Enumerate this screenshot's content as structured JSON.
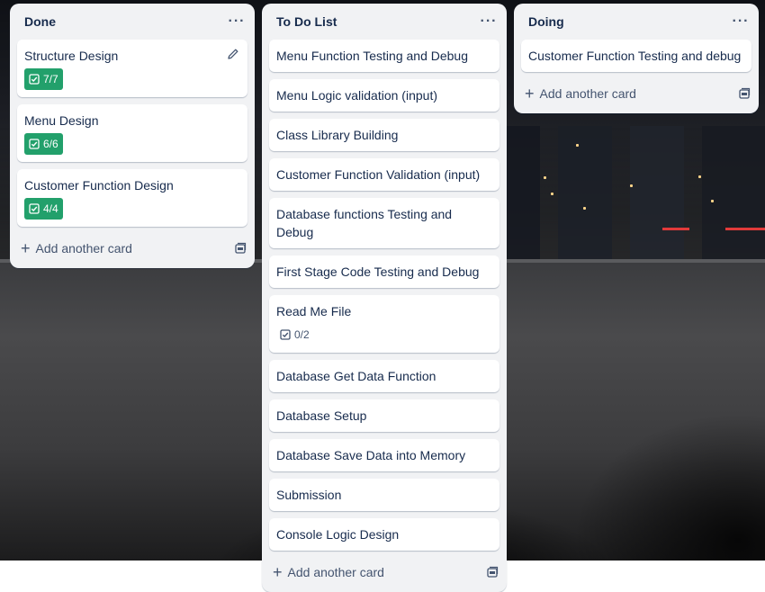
{
  "lists": [
    {
      "title": "Done",
      "menu_icon": "ellipsis-icon",
      "add_label": "Add another card",
      "cards": [
        {
          "title": "Structure Design",
          "badge": "7/7",
          "badge_complete": true,
          "show_edit": true
        },
        {
          "title": "Menu Design",
          "badge": "6/6",
          "badge_complete": true
        },
        {
          "title": "Customer Function Design",
          "badge": "4/4",
          "badge_complete": true
        }
      ]
    },
    {
      "title": "To Do List",
      "menu_icon": "ellipsis-icon",
      "add_label": "Add another card",
      "cards": [
        {
          "title": "Menu Function Testing and Debug"
        },
        {
          "title": "Menu Logic validation (input)"
        },
        {
          "title": "Class Library Building"
        },
        {
          "title": "Customer Function Validation (input)"
        },
        {
          "title": "Database functions Testing and Debug"
        },
        {
          "title": "First Stage Code Testing and Debug"
        },
        {
          "title": "Read Me File",
          "badge": "0/2",
          "badge_complete": false
        },
        {
          "title": "Database Get Data Function"
        },
        {
          "title": "Database Setup"
        },
        {
          "title": "Database Save Data into Memory"
        },
        {
          "title": "Submission"
        },
        {
          "title": "Console Logic Design"
        }
      ]
    },
    {
      "title": "Doing",
      "menu_icon": "ellipsis-icon",
      "add_label": "Add another card",
      "cards": [
        {
          "title": "Customer Function Testing and debug"
        }
      ]
    }
  ],
  "colors": {
    "list_bg": "#f1f2f4",
    "card_bg": "#ffffff",
    "badge_complete": "#22a06b",
    "text": "#172b4d",
    "muted": "#44546f"
  }
}
